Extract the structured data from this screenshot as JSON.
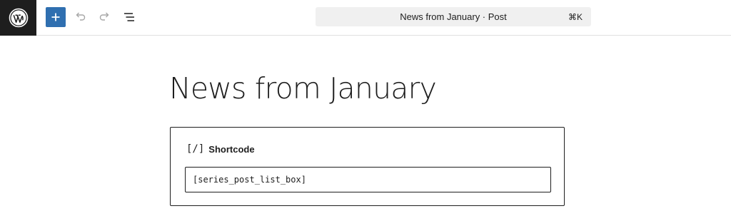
{
  "topbar": {
    "logo_icon": "wordpress-logo-icon",
    "add_block_icon": "plus-icon",
    "undo_icon": "undo-icon",
    "redo_icon": "redo-icon",
    "outline_icon": "document-overview-icon",
    "command_bar": {
      "title": "News from January · Post",
      "shortcut": "⌘K"
    }
  },
  "editor": {
    "post_title": "News from January",
    "shortcode_block": {
      "icon": "[/]",
      "label": "Shortcode",
      "value": "[series_post_list_box]"
    }
  },
  "colors": {
    "logo_bg": "#1e1e1e",
    "accent": "#2f6fb0",
    "command_bar_bg": "#f0f0f0",
    "text": "#1e1e1e"
  }
}
